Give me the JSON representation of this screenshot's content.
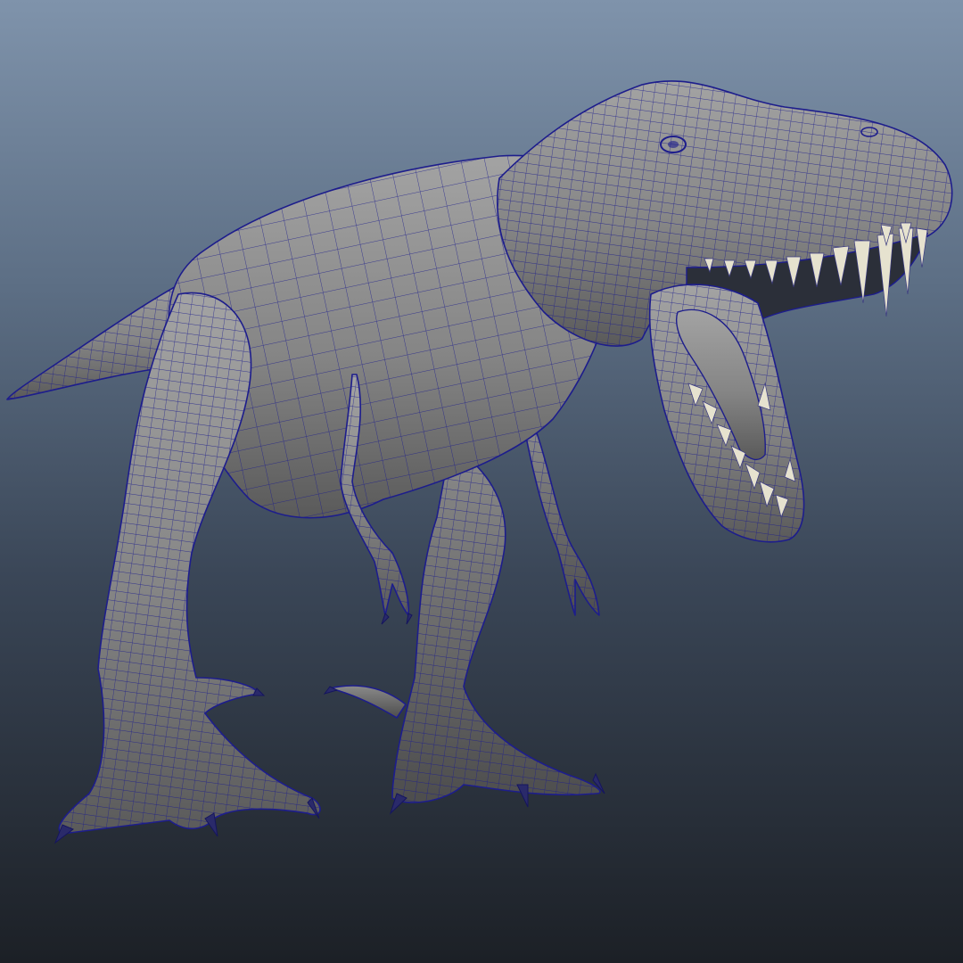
{
  "viewport": {
    "background_top": "#7f93ab",
    "background_bottom": "#1c2026",
    "mesh_color": "#1d1d8c",
    "surface_color": "#8a8a8a"
  },
  "model": {
    "subject": "tyrannosaurus-wireframe-mesh",
    "display_mode": "shaded-with-wireframe"
  }
}
